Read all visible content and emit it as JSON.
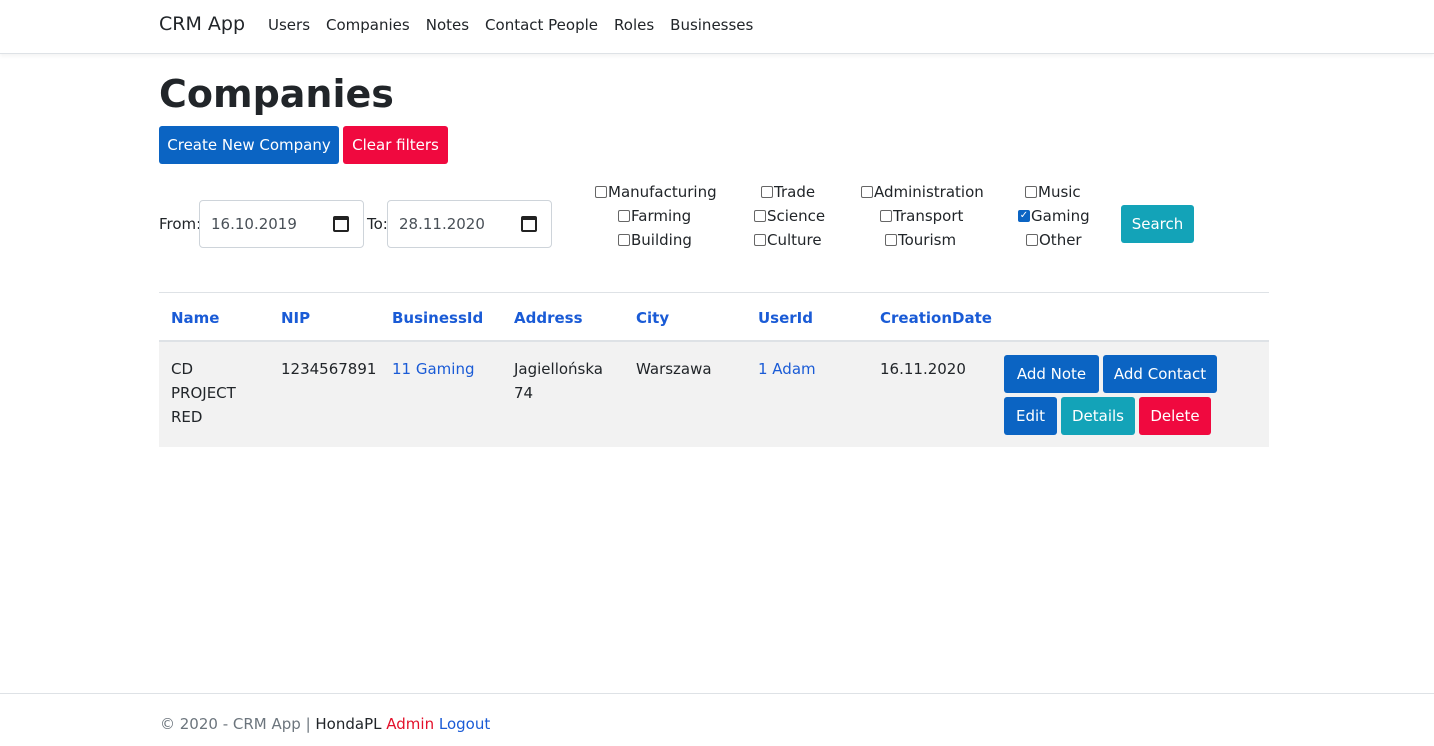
{
  "nav": {
    "brand": "CRM App",
    "links": [
      "Users",
      "Companies",
      "Notes",
      "Contact People",
      "Roles",
      "Businesses"
    ]
  },
  "page": {
    "title": "Companies",
    "create_label": "Create New Company",
    "clear_label": "Clear filters"
  },
  "filters": {
    "from_label": "From:",
    "from_value": "16.10.2019",
    "to_label": "To:",
    "to_value": "28.11.2020",
    "categories": [
      {
        "label": "Manufacturing",
        "checked": false
      },
      {
        "label": "Farming",
        "checked": false
      },
      {
        "label": "Building",
        "checked": false
      },
      {
        "label": "Trade",
        "checked": false
      },
      {
        "label": "Science",
        "checked": false
      },
      {
        "label": "Culture",
        "checked": false
      },
      {
        "label": "Administration",
        "checked": false
      },
      {
        "label": "Transport",
        "checked": false
      },
      {
        "label": "Tourism",
        "checked": false
      },
      {
        "label": "Music",
        "checked": false
      },
      {
        "label": "Gaming",
        "checked": true
      },
      {
        "label": "Other",
        "checked": false
      }
    ],
    "search_label": "Search"
  },
  "table": {
    "headers": [
      "Name",
      "NIP",
      "BusinessId",
      "Address",
      "City",
      "UserId",
      "CreationDate"
    ],
    "rows": [
      {
        "name": "CD PROJECT RED",
        "nip": "1234567891",
        "business": "11 Gaming",
        "address": "Jagiellońska 74",
        "city": "Warszawa",
        "user": "1 Adam",
        "creation_date": "16.11.2020",
        "actions": {
          "add_note": "Add Note",
          "add_contact": "Add Contact",
          "edit": "Edit",
          "details": "Details",
          "delete": "Delete"
        }
      }
    ]
  },
  "footer": {
    "copyright": "© 2020 - CRM App |",
    "user": "HondaPL",
    "role": "Admin",
    "logout": "Logout"
  },
  "colors": {
    "primary": "#0b64c3",
    "danger": "#f0093f",
    "info": "#13a3b8",
    "link": "#1a5bd6"
  }
}
